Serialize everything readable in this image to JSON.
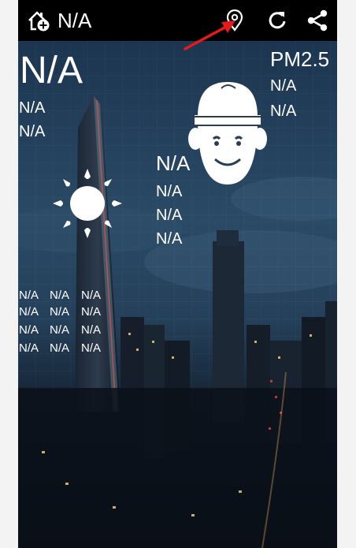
{
  "header": {
    "title": "N/A"
  },
  "weather": {
    "temperature": "N/A",
    "line1": "N/A",
    "line2": "N/A"
  },
  "air_quality": {
    "label": "PM2.5",
    "line1": "N/A",
    "line2": "N/A"
  },
  "condition": {
    "title": "N/A",
    "line1": "N/A",
    "line2": "N/A",
    "line3": "N/A"
  },
  "forecast": [
    [
      "N/A",
      "N/A",
      "N/A"
    ],
    [
      "N/A",
      "N/A",
      "N/A"
    ],
    [
      "N/A",
      "N/A",
      "N/A"
    ],
    [
      "N/A",
      "N/A",
      "N/A"
    ]
  ],
  "colors": {
    "topbar": "#000000",
    "accent_arrow": "#e31b1b",
    "text": "#ffffff"
  }
}
